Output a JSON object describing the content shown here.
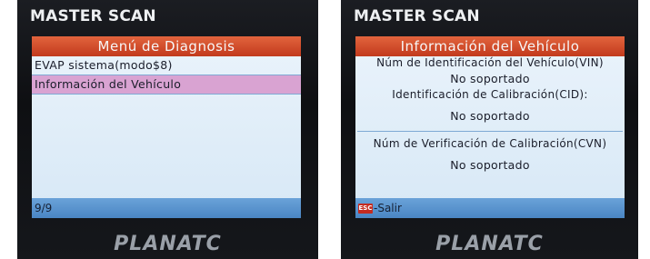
{
  "left": {
    "brand": "MASTER SCAN",
    "title": "Menú de Diagnosis",
    "items": [
      {
        "label": "EVAP sistema(modo$8)"
      },
      {
        "label": "Información del Vehículo"
      }
    ],
    "selected_index": 1,
    "footer": "9/9",
    "logo": "PLANATC"
  },
  "right": {
    "brand": "MASTER SCAN",
    "title": "Información del Vehículo",
    "vin_label": "Núm de Identificación del Vehículo(VIN)",
    "vin_value": "No soportado",
    "cid_label": "Identificación de Calibración(CID):",
    "cid_value": "No soportado",
    "cvn_label": "Núm de Verificación de Calibración(CVN)",
    "cvn_value": "No soportado",
    "esc_icon_text": "ESC",
    "esc_label": "-Salir",
    "logo": "PLANATC"
  },
  "colors": {
    "title_bar": "#c23a1d",
    "selection": "#d9a3d2",
    "footer_bar": "#4a86c4",
    "screen_bg": "#eaf3fb"
  }
}
